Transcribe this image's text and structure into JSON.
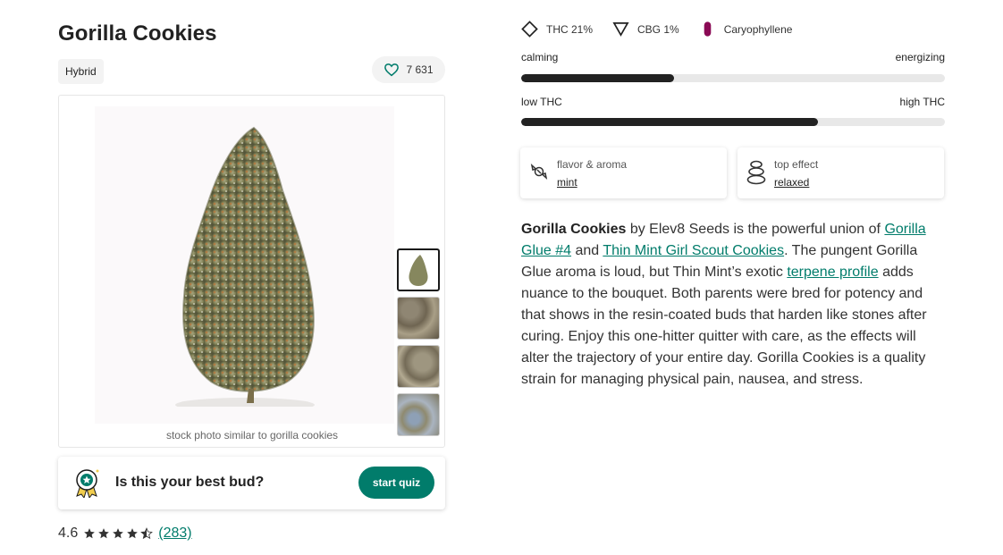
{
  "strain": {
    "name": "Gorilla Cookies",
    "type": "Hybrid",
    "likes": "7 631"
  },
  "photo": {
    "caption": "stock photo similar to gorilla cookies",
    "thumbnails": [
      {
        "name": "thumbnail-1",
        "active": true
      },
      {
        "name": "thumbnail-2",
        "active": false
      },
      {
        "name": "thumbnail-3",
        "active": false
      },
      {
        "name": "thumbnail-4",
        "active": false
      }
    ]
  },
  "quiz": {
    "prompt": "Is this your best bud?",
    "button": "start quiz"
  },
  "rating": {
    "score": "4.6",
    "stars": 4.6,
    "count": "(283)"
  },
  "chemistry": {
    "thc": "THC 21%",
    "cbg": "CBG 1%",
    "terpene": "Caryophyllene",
    "terpene_color": "#8a0a55"
  },
  "sliders": {
    "effect": {
      "left": "calming",
      "right": "energizing",
      "value_percent": 36
    },
    "potency": {
      "left": "low THC",
      "right": "high THC",
      "value_percent": 70
    }
  },
  "cards": {
    "flavor": {
      "label": "flavor & aroma",
      "value": "mint"
    },
    "effect": {
      "label": "top effect",
      "value": "relaxed"
    }
  },
  "description": {
    "strain_bold": "Gorilla Cookies",
    "t1": " by Elev8 Seeds is the powerful union of ",
    "link1": "Gorilla Glue #4",
    "t2": " and ",
    "link2": "Thin Mint Girl Scout Cookies",
    "t3": ". The pungent Gorilla Glue aroma is loud, but Thin Mint’s exotic ",
    "link3": "terpene profile",
    "t4": " adds nuance to the bouquet. Both parents were bred for potency and that shows in the resin-coated buds that harden like stones after curing. Enjoy this one-hitter quitter with care, as the effects will alter the trajectory of your entire day. Gorilla Cookies is a quality strain for managing physical pain, nausea, and stress."
  },
  "colors": {
    "accent": "#017c6b",
    "dark": "#222222",
    "track": "#e8e8e8"
  }
}
